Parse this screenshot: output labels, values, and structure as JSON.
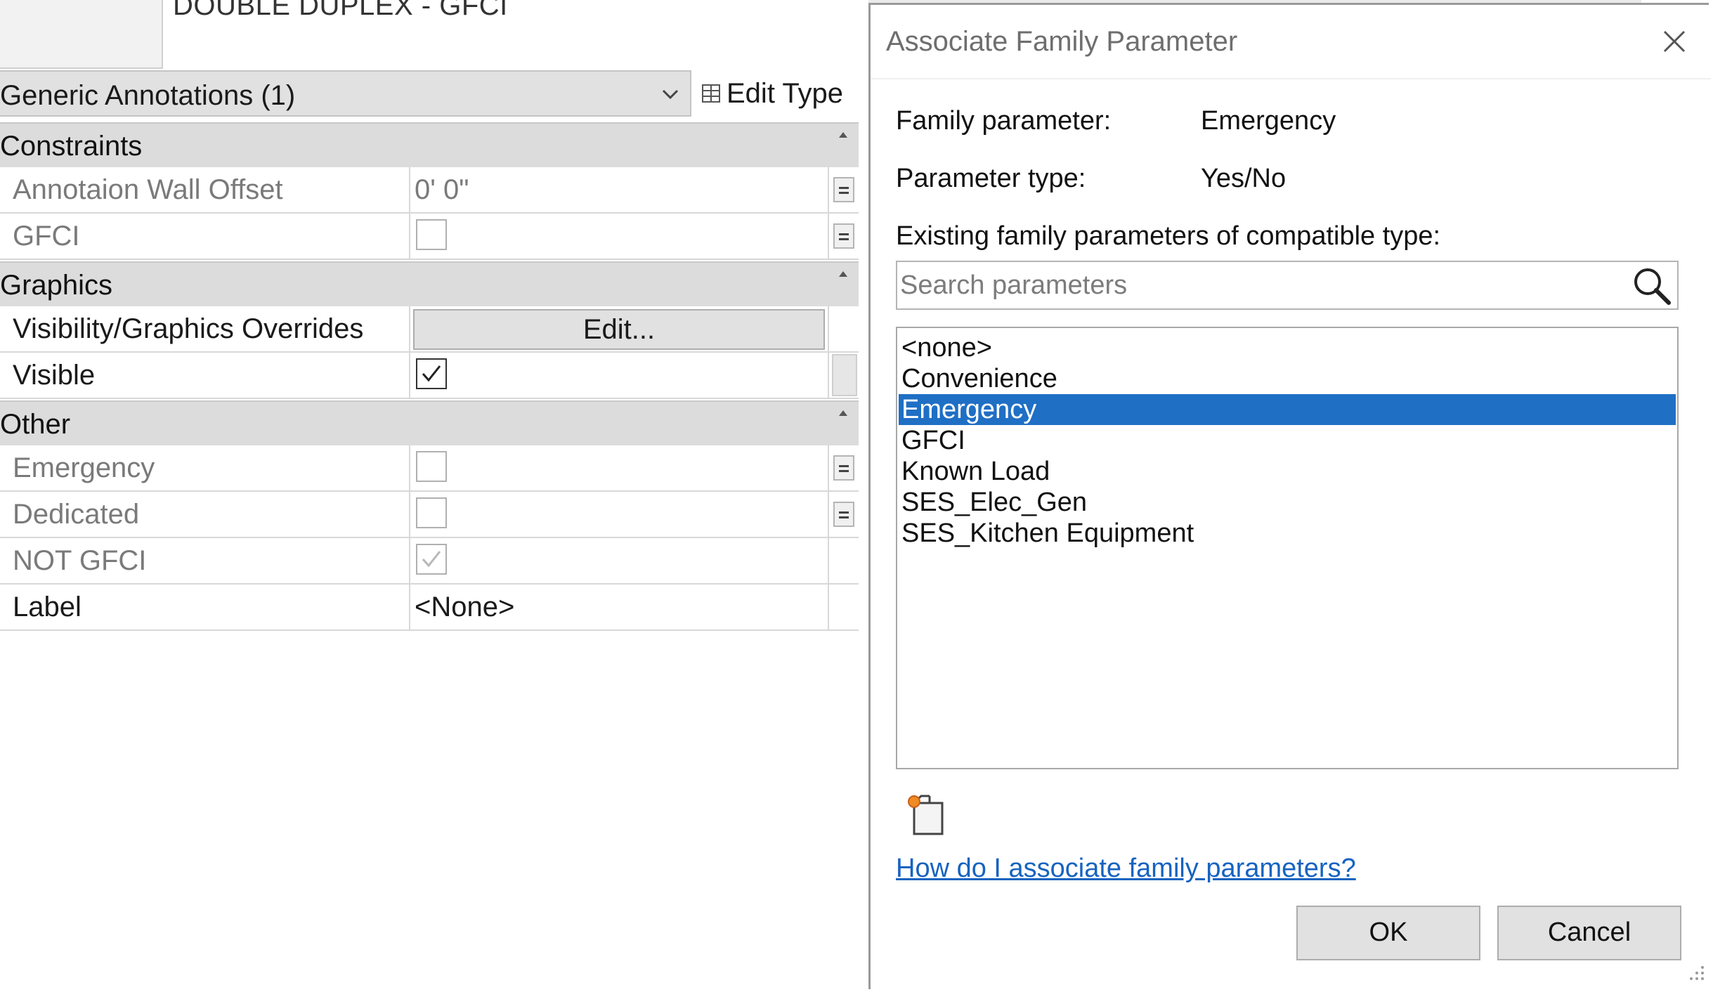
{
  "properties": {
    "type_name": "DOUBLE DUPLEX - GFCI",
    "type_selector": "Generic Annotations (1)",
    "edit_type_label": "Edit Type",
    "groups": {
      "constraints": "Constraints",
      "graphics": "Graphics",
      "other": "Other"
    },
    "rows": {
      "annotation_wall_offset": {
        "name": "Annotaion Wall Offset",
        "value": "0'  0\""
      },
      "gfci": {
        "name": "GFCI"
      },
      "vis_graphics": {
        "name": "Visibility/Graphics Overrides",
        "button": "Edit..."
      },
      "visible": {
        "name": "Visible"
      },
      "emergency": {
        "name": "Emergency"
      },
      "dedicated": {
        "name": "Dedicated"
      },
      "not_gfci": {
        "name": "NOT GFCI"
      },
      "label": {
        "name": "Label",
        "value": "<None>"
      }
    }
  },
  "dialog": {
    "title": "Associate Family Parameter",
    "family_parameter_label": "Family parameter:",
    "family_parameter_value": "Emergency",
    "parameter_type_label": "Parameter type:",
    "parameter_type_value": "Yes/No",
    "existing_label": "Existing family parameters of compatible type:",
    "search_placeholder": "Search parameters",
    "list": [
      "<none>",
      "Convenience",
      "Emergency",
      "GFCI",
      "Known Load",
      "SES_Elec_Gen",
      "SES_Kitchen Equipment"
    ],
    "selected": "Emergency",
    "help_link": "How do I associate family parameters?",
    "ok": "OK",
    "cancel": "Cancel"
  },
  "colors": {
    "selection": "#1f6fc5",
    "link": "#1763c0",
    "group_header": "#dcdcdc"
  }
}
